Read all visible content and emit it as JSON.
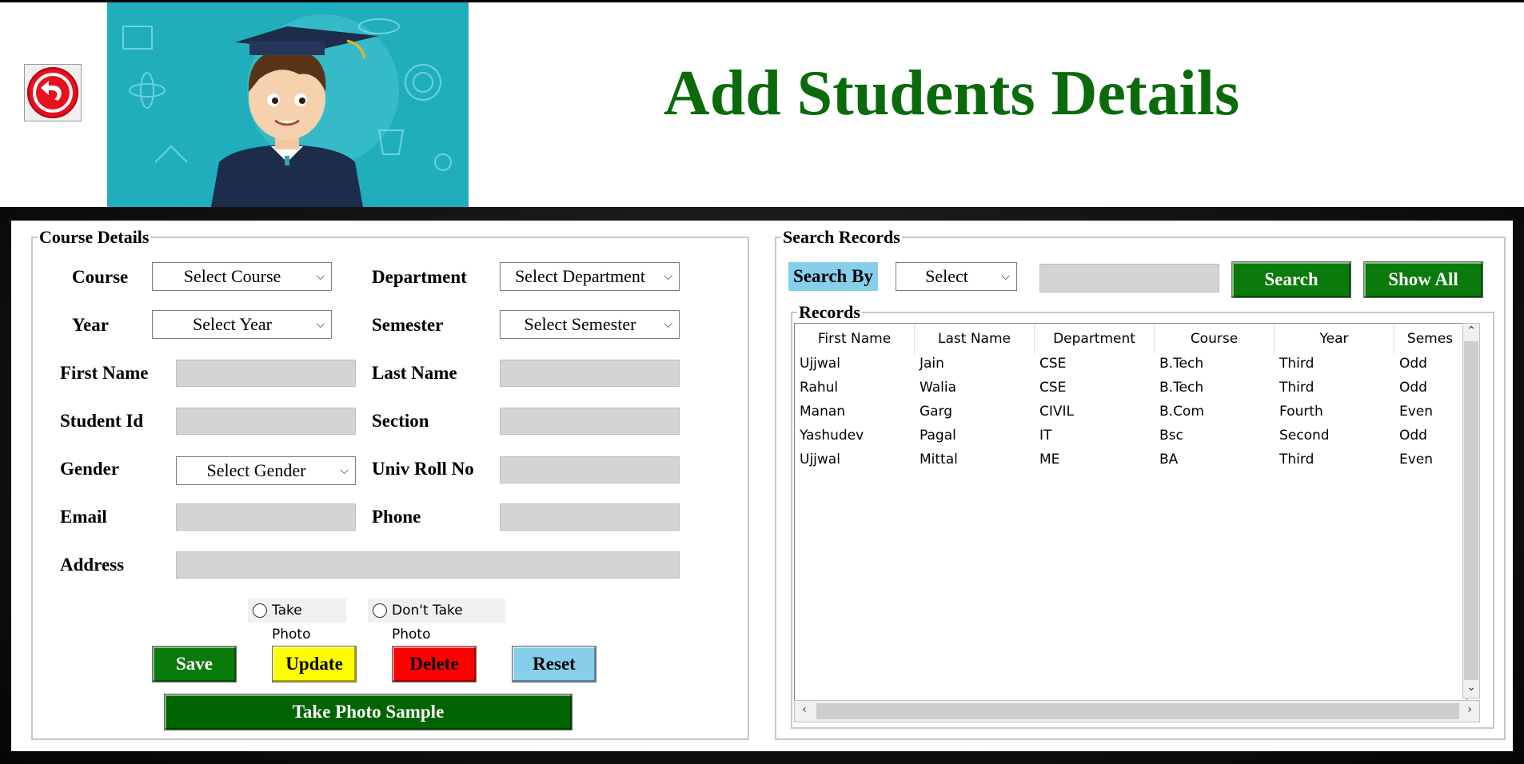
{
  "header": {
    "title": "Add Students Details",
    "title_color": "#0b6b0b"
  },
  "course_details": {
    "legend": "Course Details",
    "course_label": "Course",
    "course_value": "Select Course",
    "department_label": "Department",
    "department_value": "Select Department",
    "year_label": "Year",
    "year_value": "Select Year",
    "semester_label": "Semester",
    "semester_value": "Select Semester",
    "first_name_label": "First Name",
    "first_name_value": "",
    "last_name_label": "Last Name",
    "last_name_value": "",
    "student_id_label": "Student Id",
    "student_id_value": "",
    "section_label": "Section",
    "section_value": "",
    "gender_label": "Gender",
    "gender_value": "Select Gender",
    "univ_roll_label": "Univ Roll No",
    "univ_roll_value": "",
    "email_label": "Email",
    "email_value": "",
    "phone_label": "Phone",
    "phone_value": "",
    "address_label": "Address",
    "address_value": "",
    "radio_take_photo": "Take Photo",
    "radio_dont_take_photo": "Don't Take Photo",
    "save_label": "Save",
    "update_label": "Update",
    "delete_label": "Delete",
    "reset_label": "Reset",
    "take_photo_sample_label": "Take Photo Sample"
  },
  "search": {
    "legend": "Search Records",
    "search_by_label": "Search By",
    "search_by_value": "Select",
    "search_text": "",
    "search_button": "Search",
    "show_all_button": "Show All"
  },
  "records": {
    "legend": "Records",
    "columns": [
      "First Name",
      "Last Name",
      "Department",
      "Course",
      "Year",
      "Semes"
    ],
    "rows": [
      [
        "Ujjwal",
        "Jain",
        "CSE",
        "B.Tech",
        "Third",
        "Odd"
      ],
      [
        "Rahul",
        "Walia",
        "CSE",
        "B.Tech",
        "Third",
        "Odd"
      ],
      [
        "Manan",
        "Garg",
        "CIVIL",
        "B.Com",
        "Fourth",
        "Even"
      ],
      [
        "Yashudev",
        "Pagal",
        "IT",
        "Bsc",
        "Second",
        "Odd"
      ],
      [
        "Ujjwal",
        "Mittal",
        "ME",
        "BA",
        "Third",
        "Even"
      ]
    ]
  },
  "colors": {
    "save": "#0a7a0a",
    "update": "#ffff00",
    "delete": "#ff0000",
    "reset": "#87ceeb",
    "search": "#0a7a0a",
    "take_photo_sample": "#006400",
    "search_by_bg": "#87ceeb"
  },
  "icons": {
    "back": "back-arrow-icon",
    "dropdown": "chevron-down-icon"
  }
}
